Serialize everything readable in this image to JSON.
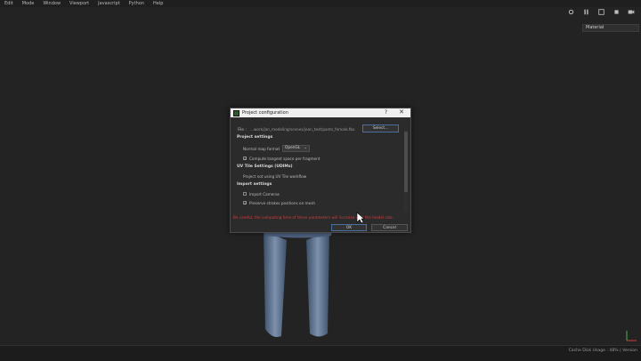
{
  "menu": [
    "Edit",
    "Mode",
    "Window",
    "Viewport",
    "Javascript",
    "Python",
    "Help"
  ],
  "toolbar_icons": [
    "settings-icon",
    "pause-icon",
    "frame-icon",
    "layers-icon",
    "camera-icon"
  ],
  "viewport": {
    "selected": "Material"
  },
  "dialog": {
    "title": "Project configuration",
    "help": "?",
    "close": "✕",
    "file_label": "File :",
    "file_path": "...work/jan_modeling/scenes/jean_test/pants_female.fbx",
    "select_button": "Select...",
    "project_settings": "Project settings",
    "normal_map_label": "Normal map format",
    "normal_map_value": "OpenGL",
    "compute_tangent": "Compute tangent space per fragment",
    "uv_heading": "UV Tile Settings (UDIMs)",
    "uv_value": "Project not using UV Tile workflow",
    "import_settings": "Import settings",
    "import_cameras": "Import Cameras",
    "preserve_strokes": "Preserve strokes positions on mesh",
    "warning": "Be careful, the computing time of these parameters will increase with the model size.",
    "ok": "OK",
    "cancel": "Cancel"
  },
  "status": {
    "text": "Cache Disk Usage : 48% | Version"
  }
}
